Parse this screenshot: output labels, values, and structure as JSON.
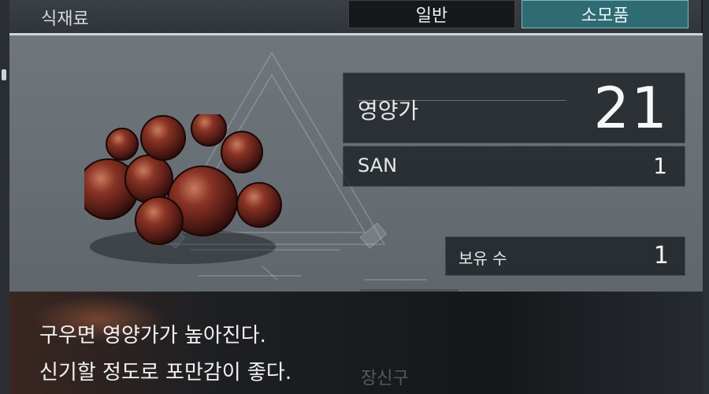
{
  "header": {
    "category": "식재료",
    "tabs": [
      {
        "label": "일반",
        "active": false
      },
      {
        "label": "소모품",
        "active": true
      }
    ]
  },
  "item": {
    "image": "fried-meatballs",
    "stats": {
      "nutrition_label": "영양가",
      "nutrition_value": "21",
      "san_label": "SAN",
      "san_value": "1",
      "owned_label": "보유 수",
      "owned_value": "1"
    }
  },
  "description": {
    "line1": "구우면 영양가가 높아진다.",
    "line2": "신기할 정도로 포만감이 좋다.",
    "behind_text": "장신구"
  },
  "colors": {
    "panel": "#6f767c",
    "active_tab": "#2f6b72",
    "inactive_tab": "#16181b",
    "stat_box": "#14181c"
  }
}
